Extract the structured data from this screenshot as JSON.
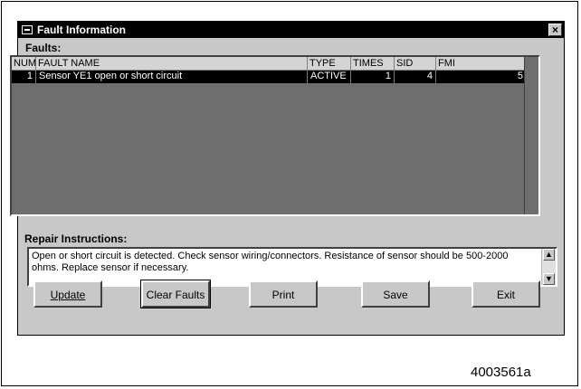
{
  "window": {
    "title": "Fault Information",
    "close_glyph": "×"
  },
  "faults_label": "Faults:",
  "table": {
    "columns": [
      "NUM",
      "FAULT NAME",
      "TYPE",
      "TIMES",
      "SID",
      "FMI"
    ],
    "rows": [
      {
        "num": "1",
        "fault_name": "Sensor YE1 open or short circuit",
        "type": "ACTIVE",
        "times": "1",
        "sid": "4",
        "fmi": "5"
      }
    ]
  },
  "repair": {
    "label": "Repair Instructions:",
    "text": "Open or short circuit is detected. Check sensor wiring/connectors. Resistance of sensor should be 500-2000 ohms. Replace sensor if necessary."
  },
  "buttons": {
    "update": "Update",
    "clear_faults": "Clear Faults",
    "print": "Print",
    "save": "Save",
    "exit": "Exit"
  },
  "figure_id": "4003561a"
}
